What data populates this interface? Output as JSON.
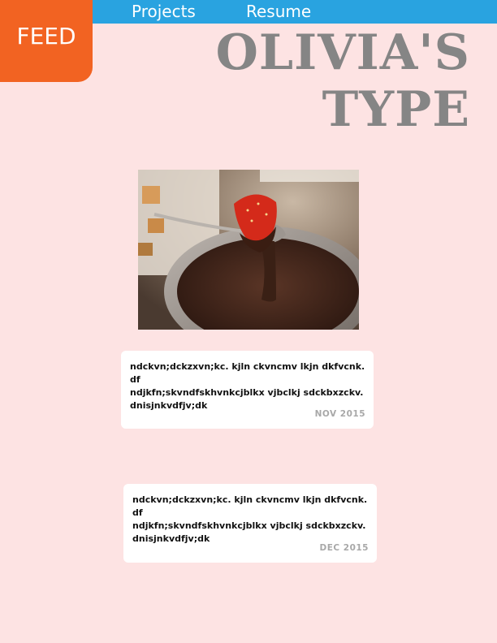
{
  "nav": {
    "projects_label": "Projects",
    "resume_label": "Resume",
    "feed_label": "FEED"
  },
  "header": {
    "title_line1": "OLIVIA'S",
    "title_line2": "TYPE"
  },
  "posts": [
    {
      "text": " ndckvn;dckzxvn;kc. kjln ckvncmv lkjn dkfvcnk. df\nndjkfn;skvndfskhvnkcjblkx vjbclkj sdckbxzckv.\ndnisjnkvdfjv;dk",
      "date": "NOV 2015"
    },
    {
      "text": " ndckvn;dckzxvn;kc. kjln ckvncmv lkjn dkfvcnk. df\nndjkfn;skvndfskhvnkcjblkx vjbclkj sdckbxzckv.\ndnisjnkvdfjv;dk",
      "date": "DEC 2015"
    }
  ],
  "colors": {
    "topbar": "#29a3e0",
    "feed_tab": "#f26322",
    "background": "#fde3e3",
    "title": "#858585"
  }
}
